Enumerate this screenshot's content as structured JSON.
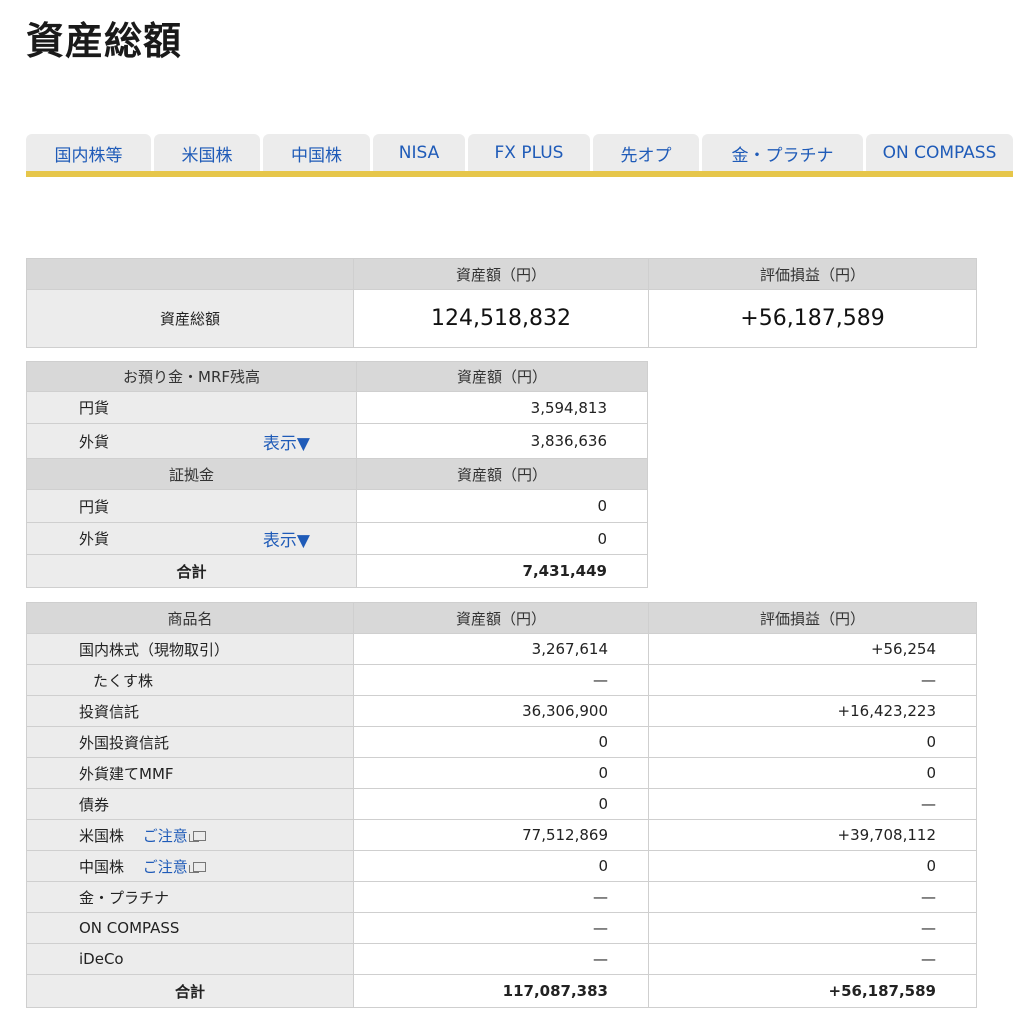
{
  "page": {
    "title": "資産総額"
  },
  "tabs": [
    "国内株等",
    "米国株",
    "中国株",
    "NISA",
    "FX PLUS",
    "先オプ",
    "金・プラチナ",
    "ON COMPASS"
  ],
  "summary": {
    "col_asset": "資産額（円）",
    "col_pl": "評価損益（円）",
    "row_label": "資産総額",
    "total_asset": "124,518,832",
    "total_pl": "+56,187,589"
  },
  "cash": {
    "header_deposit": "お預り金・MRF残高",
    "header_asset": "資産額（円）",
    "deposit_rows": [
      {
        "label": "円貨",
        "value": "3,594,813"
      },
      {
        "label": "外貨",
        "link": "表示▼",
        "value": "3,836,636"
      }
    ],
    "header_margin": "証拠金",
    "margin_rows": [
      {
        "label": "円貨",
        "value": "0"
      },
      {
        "label": "外貨",
        "link": "表示▼",
        "value": "0"
      }
    ],
    "total_label": "合計",
    "total_value": "7,431,449"
  },
  "products": {
    "col_name": "商品名",
    "col_asset": "資産額（円）",
    "col_pl": "評価損益（円）",
    "rows": [
      {
        "name": "国内株式（現物取引）",
        "asset": "3,267,614",
        "pl": "+56,254"
      },
      {
        "name": "たくす株",
        "asset": "—",
        "pl": "—"
      },
      {
        "name": "投資信託",
        "asset": "36,306,900",
        "pl": "+16,423,223"
      },
      {
        "name": "外国投資信託",
        "asset": "0",
        "pl": "0"
      },
      {
        "name": "外貨建てMMF",
        "asset": "0",
        "pl": "0"
      },
      {
        "name": "債券",
        "asset": "0",
        "pl": "—"
      },
      {
        "name": "米国株",
        "note": "ご注意",
        "asset": "77,512,869",
        "pl": "+39,708,112"
      },
      {
        "name": "中国株",
        "note": "ご注意",
        "asset": "0",
        "pl": "0"
      },
      {
        "name": "金・プラチナ",
        "asset": "—",
        "pl": "—"
      },
      {
        "name": "ON COMPASS",
        "asset": "—",
        "pl": "—"
      },
      {
        "name": "iDeCo",
        "asset": "—",
        "pl": "—"
      }
    ],
    "total_label": "合計",
    "total_asset": "117,087,383",
    "total_pl": "+56,187,589"
  },
  "colors": {
    "accent_bar": "#e6c64a",
    "link": "#1f5bb8",
    "header_bg": "#d8d8d8",
    "label_bg": "#ececec"
  }
}
